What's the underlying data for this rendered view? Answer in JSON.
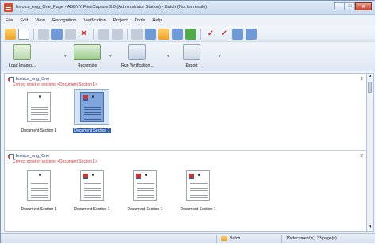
{
  "window": {
    "title": "Invoice_eng_One_Page - ABBYY FlexiCapture 9.0 (Administrator Station) - Batch (Not for resale)",
    "controls": {
      "minimize": "─",
      "maximize": "□",
      "close": "✕"
    }
  },
  "menu": [
    "File",
    "Edit",
    "View",
    "Recognition",
    "Verification",
    "Project",
    "Tools",
    "Help"
  ],
  "big_toolbar": {
    "load_images": "Load Images...",
    "recognize": "Recognize",
    "run_verification": "Run Verification...",
    "export": "Export",
    "dropdown_glyph": "▾"
  },
  "documents": [
    {
      "name": "Invoice_eng_One",
      "error": "Correct order of sections <Document Section 1>",
      "number": "1",
      "pages": [
        {
          "label": "Document Section 1",
          "selected": false
        },
        {
          "label": "Document Section 1",
          "selected": true
        }
      ]
    },
    {
      "name": "Invoice_eng_One",
      "error": "Correct order of sections <Document Section 1>",
      "number": "2",
      "pages": [
        {
          "label": "Document Section 1",
          "selected": false
        },
        {
          "label": "Document Section 1",
          "selected": false
        },
        {
          "label": "Document Section 1",
          "selected": false
        },
        {
          "label": "Document Section 1",
          "selected": false
        }
      ]
    }
  ],
  "scrollbar": {
    "up": "▲",
    "down": "▼"
  },
  "status": {
    "batch": "Batch",
    "count": "19 document(s), 23 page(s)"
  }
}
